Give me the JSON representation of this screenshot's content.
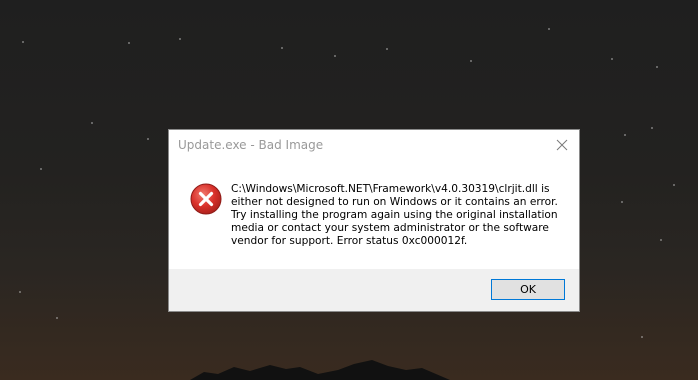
{
  "dialog": {
    "title": "Update.exe - Bad Image",
    "message": "C:\\Windows\\Microsoft.NET\\Framework\\v4.0.30319\\clrjit.dll is either not designed to run on Windows or it contains an error. Try installing the program again using the original installation media or contact your system administrator or the software vendor for support. Error status 0xc000012f.",
    "icon": "error-icon",
    "ok_label": "OK",
    "close_icon": "close-icon"
  },
  "colors": {
    "error_red": "#d9312b",
    "button_border": "#0078d7",
    "title_gray": "#999999",
    "footer_bg": "#f0f0f0"
  }
}
